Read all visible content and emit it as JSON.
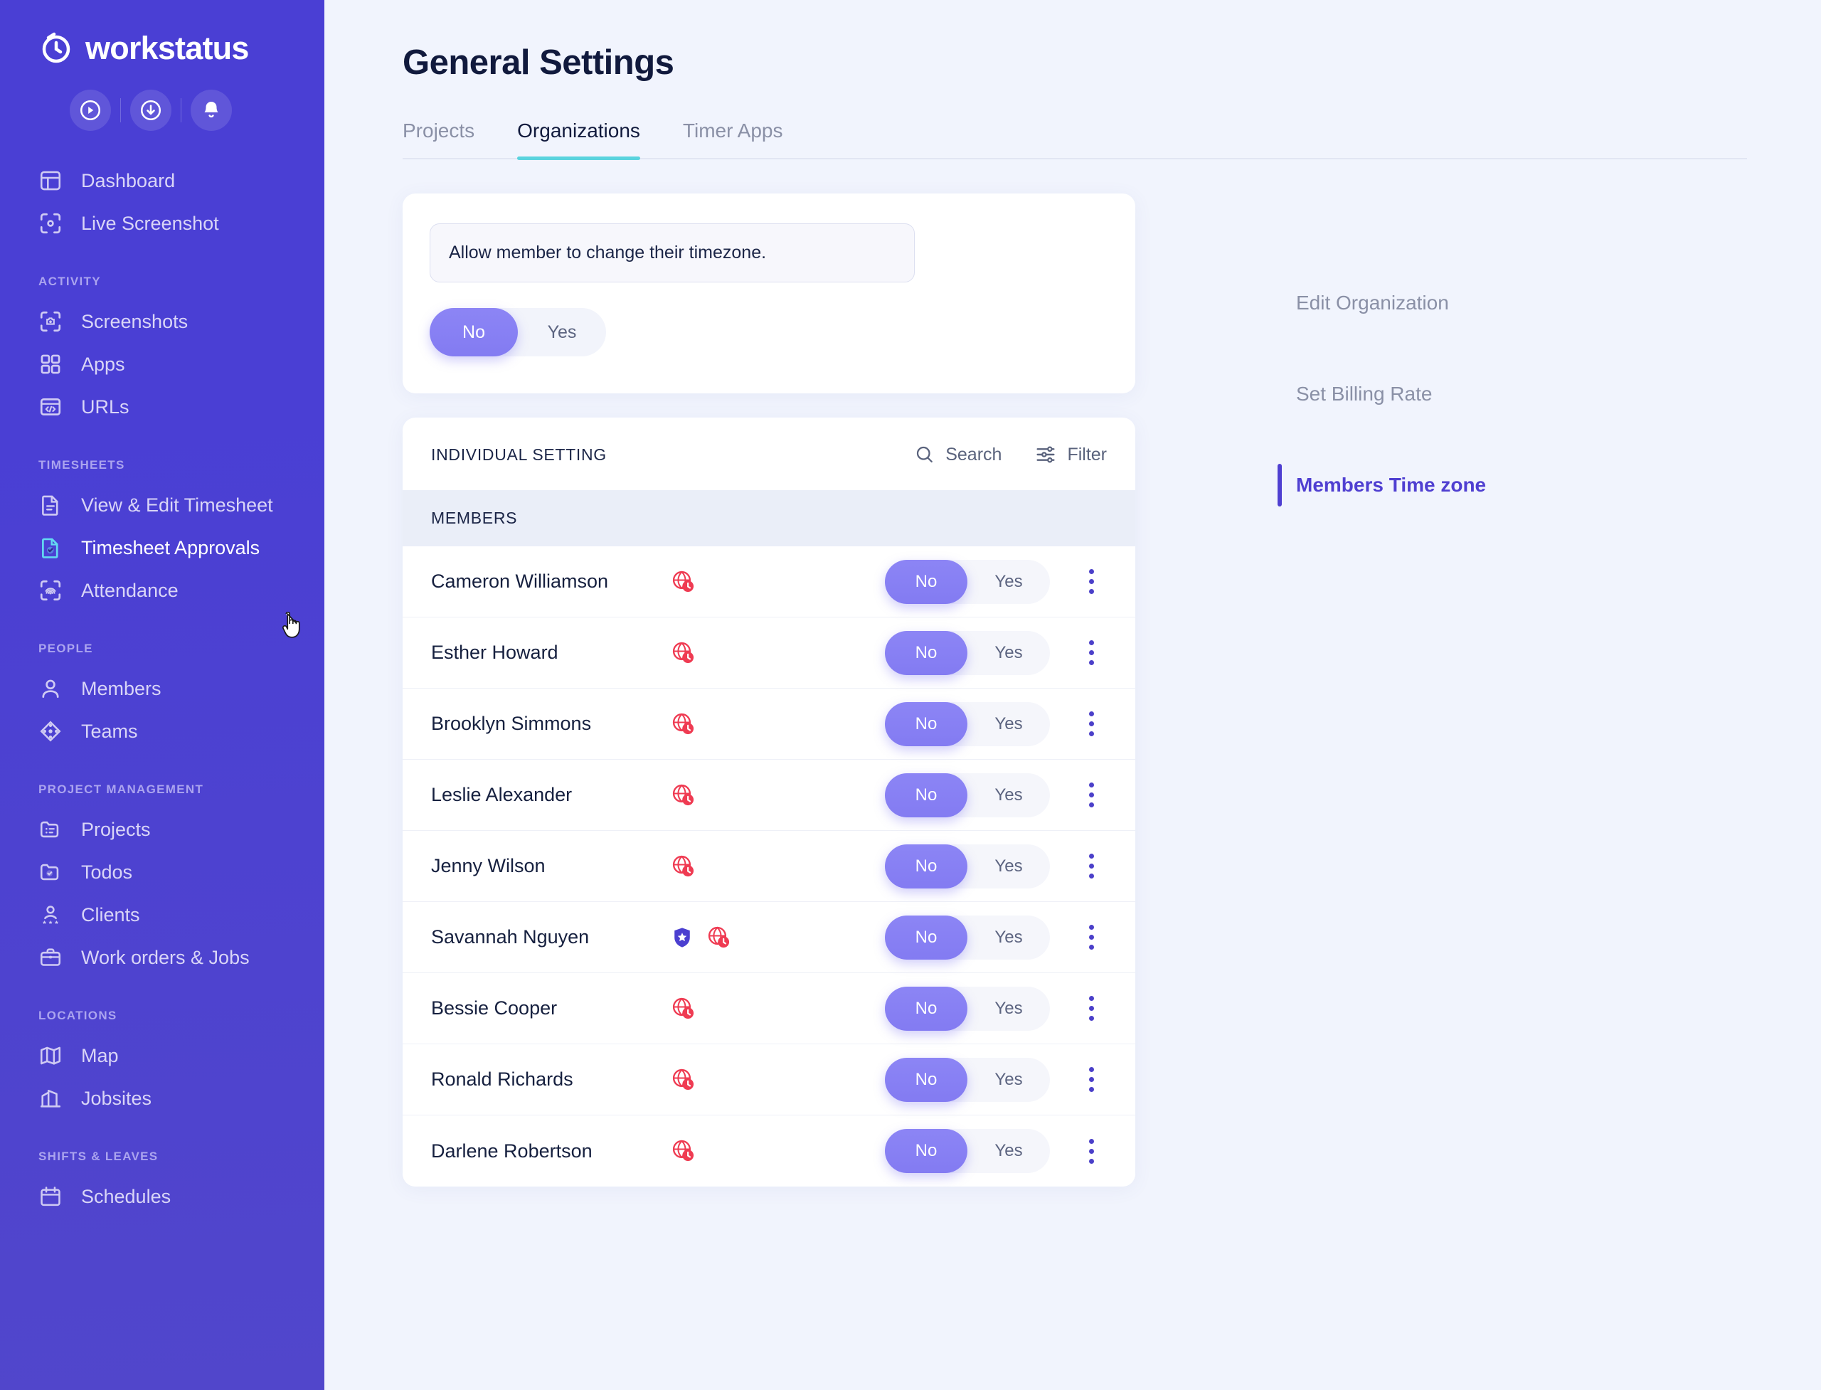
{
  "brand": {
    "name": "workstatus",
    "logo_icon": "timer-logo-icon"
  },
  "quick_actions": [
    {
      "icon": "play-circle-icon",
      "name": "start-timer"
    },
    {
      "icon": "download-circle-icon",
      "name": "download"
    },
    {
      "icon": "bell-icon",
      "name": "notifications"
    }
  ],
  "sidebar": {
    "top_items": [
      {
        "label": "Dashboard",
        "icon": "dashboard-icon"
      },
      {
        "label": "Live Screenshot",
        "icon": "live-screenshot-icon"
      }
    ],
    "sections": [
      {
        "label": "ACTIVITY",
        "items": [
          {
            "label": "Screenshots",
            "icon": "screenshots-icon"
          },
          {
            "label": "Apps",
            "icon": "apps-grid-icon"
          },
          {
            "label": "URLs",
            "icon": "urls-code-icon"
          }
        ]
      },
      {
        "label": "TIMESHEETS",
        "items": [
          {
            "label": "View & Edit Timesheet",
            "icon": "document-lines-icon"
          },
          {
            "label": "Timesheet Approvals",
            "icon": "document-check-icon",
            "active": true
          },
          {
            "label": "Attendance",
            "icon": "fingerprint-icon"
          }
        ]
      },
      {
        "label": "PEOPLE",
        "items": [
          {
            "label": "Members",
            "icon": "user-icon"
          },
          {
            "label": "Teams",
            "icon": "teams-network-icon"
          }
        ]
      },
      {
        "label": "PROJECT MANAGEMENT",
        "items": [
          {
            "label": "Projects",
            "icon": "folder-list-icon"
          },
          {
            "label": "Todos",
            "icon": "folder-check-icon"
          },
          {
            "label": "Clients",
            "icon": "clients-star-icon"
          },
          {
            "label": "Work orders & Jobs",
            "icon": "briefcase-icon"
          }
        ]
      },
      {
        "label": "LOCATIONS",
        "items": [
          {
            "label": "Map",
            "icon": "map-icon"
          },
          {
            "label": "Jobsites",
            "icon": "building-icon"
          }
        ]
      },
      {
        "label": "SHIFTS & LEAVES",
        "items": [
          {
            "label": "Schedules",
            "icon": "calendar-icon"
          }
        ]
      }
    ]
  },
  "header": {
    "title": "General Settings"
  },
  "tabs": [
    {
      "label": "Projects",
      "active": false
    },
    {
      "label": "Organizations",
      "active": true
    },
    {
      "label": "Timer Apps",
      "active": false
    }
  ],
  "timezone_setting": {
    "description": "Allow member to change their timezone.",
    "options": [
      {
        "label": "No",
        "selected": true
      },
      {
        "label": "Yes",
        "selected": false
      }
    ]
  },
  "individual_setting": {
    "title": "INDIVIDUAL SETTING",
    "search_label": "Search",
    "search_icon": "search-icon",
    "filter_label": "Filter",
    "filter_icon": "filter-sliders-icon",
    "members_column_header": "MEMBERS",
    "toggle_options": [
      {
        "label": "No",
        "selected": true
      },
      {
        "label": "Yes",
        "selected": false
      }
    ],
    "members": [
      {
        "name": "Cameron Williamson",
        "admin_badge": false,
        "timezone_icon": "globe-clock-icon",
        "toggle": "No"
      },
      {
        "name": "Esther Howard",
        "admin_badge": false,
        "timezone_icon": "globe-clock-icon",
        "toggle": "No"
      },
      {
        "name": "Brooklyn Simmons",
        "admin_badge": false,
        "timezone_icon": "globe-clock-icon",
        "toggle": "No"
      },
      {
        "name": "Leslie Alexander",
        "admin_badge": false,
        "timezone_icon": "globe-clock-icon",
        "toggle": "No"
      },
      {
        "name": "Jenny Wilson",
        "admin_badge": false,
        "timezone_icon": "globe-clock-icon",
        "toggle": "No"
      },
      {
        "name": "Savannah Nguyen",
        "admin_badge": true,
        "timezone_icon": "globe-clock-icon",
        "toggle": "No"
      },
      {
        "name": "Bessie Cooper",
        "admin_badge": false,
        "timezone_icon": "globe-clock-icon",
        "toggle": "No"
      },
      {
        "name": "Ronald Richards",
        "admin_badge": false,
        "timezone_icon": "globe-clock-icon",
        "toggle": "No"
      },
      {
        "name": "Darlene Robertson",
        "admin_badge": false,
        "timezone_icon": "globe-clock-icon",
        "toggle": "No"
      }
    ]
  },
  "right_panel": {
    "items": [
      {
        "label": "Edit Organization",
        "active": false
      },
      {
        "label": "Set Billing Rate",
        "active": false
      },
      {
        "label": "Members Time zone",
        "active": true
      }
    ]
  },
  "colors": {
    "sidebar": "#4a3fd4",
    "accent_purple": "#4f3fd1",
    "toggle_on": "#837bf2",
    "tab_underline": "#5ad3de",
    "timezone_icon_red": "#ef3b52",
    "page_bg": "#f1f4fd",
    "active_nav_icon": "#63d8f1"
  }
}
